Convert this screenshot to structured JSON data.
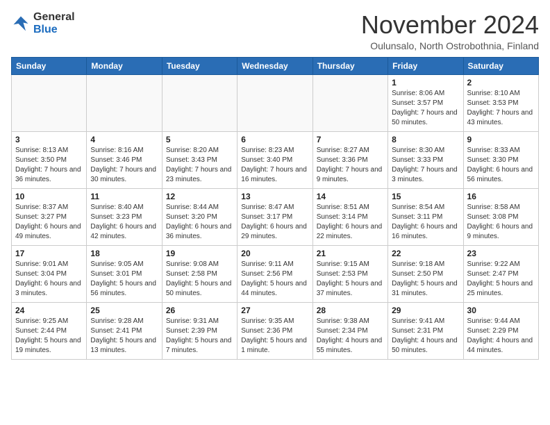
{
  "logo": {
    "general": "General",
    "blue": "Blue"
  },
  "header": {
    "month": "November 2024",
    "location": "Oulunsalo, North Ostrobothnia, Finland"
  },
  "weekdays": [
    "Sunday",
    "Monday",
    "Tuesday",
    "Wednesday",
    "Thursday",
    "Friday",
    "Saturday"
  ],
  "weeks": [
    [
      {
        "day": "",
        "info": ""
      },
      {
        "day": "",
        "info": ""
      },
      {
        "day": "",
        "info": ""
      },
      {
        "day": "",
        "info": ""
      },
      {
        "day": "",
        "info": ""
      },
      {
        "day": "1",
        "info": "Sunrise: 8:06 AM\nSunset: 3:57 PM\nDaylight: 7 hours and 50 minutes."
      },
      {
        "day": "2",
        "info": "Sunrise: 8:10 AM\nSunset: 3:53 PM\nDaylight: 7 hours and 43 minutes."
      }
    ],
    [
      {
        "day": "3",
        "info": "Sunrise: 8:13 AM\nSunset: 3:50 PM\nDaylight: 7 hours and 36 minutes."
      },
      {
        "day": "4",
        "info": "Sunrise: 8:16 AM\nSunset: 3:46 PM\nDaylight: 7 hours and 30 minutes."
      },
      {
        "day": "5",
        "info": "Sunrise: 8:20 AM\nSunset: 3:43 PM\nDaylight: 7 hours and 23 minutes."
      },
      {
        "day": "6",
        "info": "Sunrise: 8:23 AM\nSunset: 3:40 PM\nDaylight: 7 hours and 16 minutes."
      },
      {
        "day": "7",
        "info": "Sunrise: 8:27 AM\nSunset: 3:36 PM\nDaylight: 7 hours and 9 minutes."
      },
      {
        "day": "8",
        "info": "Sunrise: 8:30 AM\nSunset: 3:33 PM\nDaylight: 7 hours and 3 minutes."
      },
      {
        "day": "9",
        "info": "Sunrise: 8:33 AM\nSunset: 3:30 PM\nDaylight: 6 hours and 56 minutes."
      }
    ],
    [
      {
        "day": "10",
        "info": "Sunrise: 8:37 AM\nSunset: 3:27 PM\nDaylight: 6 hours and 49 minutes."
      },
      {
        "day": "11",
        "info": "Sunrise: 8:40 AM\nSunset: 3:23 PM\nDaylight: 6 hours and 42 minutes."
      },
      {
        "day": "12",
        "info": "Sunrise: 8:44 AM\nSunset: 3:20 PM\nDaylight: 6 hours and 36 minutes."
      },
      {
        "day": "13",
        "info": "Sunrise: 8:47 AM\nSunset: 3:17 PM\nDaylight: 6 hours and 29 minutes."
      },
      {
        "day": "14",
        "info": "Sunrise: 8:51 AM\nSunset: 3:14 PM\nDaylight: 6 hours and 22 minutes."
      },
      {
        "day": "15",
        "info": "Sunrise: 8:54 AM\nSunset: 3:11 PM\nDaylight: 6 hours and 16 minutes."
      },
      {
        "day": "16",
        "info": "Sunrise: 8:58 AM\nSunset: 3:08 PM\nDaylight: 6 hours and 9 minutes."
      }
    ],
    [
      {
        "day": "17",
        "info": "Sunrise: 9:01 AM\nSunset: 3:04 PM\nDaylight: 6 hours and 3 minutes."
      },
      {
        "day": "18",
        "info": "Sunrise: 9:05 AM\nSunset: 3:01 PM\nDaylight: 5 hours and 56 minutes."
      },
      {
        "day": "19",
        "info": "Sunrise: 9:08 AM\nSunset: 2:58 PM\nDaylight: 5 hours and 50 minutes."
      },
      {
        "day": "20",
        "info": "Sunrise: 9:11 AM\nSunset: 2:56 PM\nDaylight: 5 hours and 44 minutes."
      },
      {
        "day": "21",
        "info": "Sunrise: 9:15 AM\nSunset: 2:53 PM\nDaylight: 5 hours and 37 minutes."
      },
      {
        "day": "22",
        "info": "Sunrise: 9:18 AM\nSunset: 2:50 PM\nDaylight: 5 hours and 31 minutes."
      },
      {
        "day": "23",
        "info": "Sunrise: 9:22 AM\nSunset: 2:47 PM\nDaylight: 5 hours and 25 minutes."
      }
    ],
    [
      {
        "day": "24",
        "info": "Sunrise: 9:25 AM\nSunset: 2:44 PM\nDaylight: 5 hours and 19 minutes."
      },
      {
        "day": "25",
        "info": "Sunrise: 9:28 AM\nSunset: 2:41 PM\nDaylight: 5 hours and 13 minutes."
      },
      {
        "day": "26",
        "info": "Sunrise: 9:31 AM\nSunset: 2:39 PM\nDaylight: 5 hours and 7 minutes."
      },
      {
        "day": "27",
        "info": "Sunrise: 9:35 AM\nSunset: 2:36 PM\nDaylight: 5 hours and 1 minute."
      },
      {
        "day": "28",
        "info": "Sunrise: 9:38 AM\nSunset: 2:34 PM\nDaylight: 4 hours and 55 minutes."
      },
      {
        "day": "29",
        "info": "Sunrise: 9:41 AM\nSunset: 2:31 PM\nDaylight: 4 hours and 50 minutes."
      },
      {
        "day": "30",
        "info": "Sunrise: 9:44 AM\nSunset: 2:29 PM\nDaylight: 4 hours and 44 minutes."
      }
    ]
  ]
}
